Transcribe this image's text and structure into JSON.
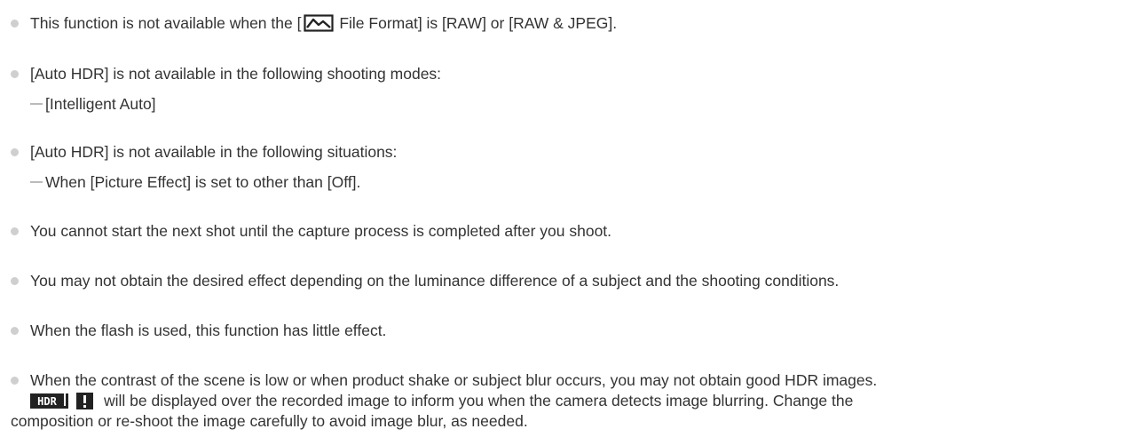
{
  "notes": [
    {
      "pre": "This function is not available when the [",
      "icon": "picture-file-format-icon",
      "post": " File Format] is [RAW] or [RAW & JPEG]."
    },
    {
      "text": "[Auto HDR] is not available in the following shooting modes:",
      "sub": "[Intelligent Auto]"
    },
    {
      "text": "[Auto HDR] is not available in the following situations:",
      "sub": "When [Picture Effect] is set to other than [Off]."
    },
    {
      "text": "You cannot start the next shot until the capture process is completed after you shoot."
    },
    {
      "text": "You may not obtain the desired effect depending on the luminance difference of a subject and the shooting conditions."
    },
    {
      "text": "When the flash is used, this function has little effect."
    },
    {
      "line1": "When the contrast of the scene is low or when product shake or subject blur occurs, you may not obtain good HDR images.",
      "icons": [
        "hdr-icon",
        "warning-icon"
      ],
      "hdr_text": "HDR",
      "line2": "will be displayed over the recorded image to inform you when the camera detects image blurring. Change the",
      "line3": "composition or re-shoot the image carefully to avoid image blur, as needed."
    }
  ],
  "colors": {
    "text": "#333333",
    "bullet": "#cfcfcf",
    "dash": "#bbbbbb",
    "icon": "#222222"
  }
}
